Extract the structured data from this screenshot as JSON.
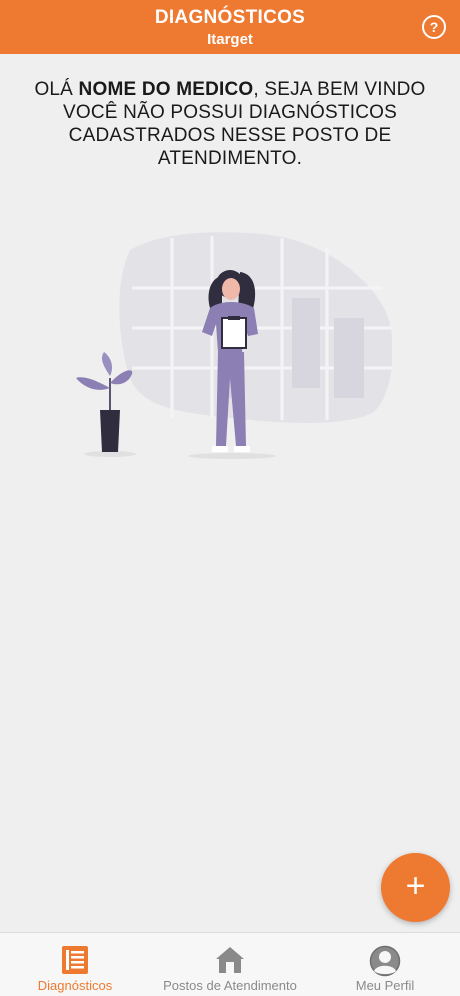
{
  "header": {
    "title": "DIAGNÓSTICOS",
    "subtitle": "Itarget",
    "help_label": "?"
  },
  "message": {
    "greeting": "OLÁ ",
    "doctor_name": "NOME DO MEDICO",
    "welcome": ", SEJA BEM VINDO",
    "empty_text": "VOCÊ NÃO POSSUI DIAGNÓSTICOS CADASTRADOS NESSE POSTO DE ATENDIMENTO."
  },
  "fab": {
    "label": "+"
  },
  "bottom_nav": {
    "items": [
      {
        "label": "Diagnósticos",
        "icon": "document-list-icon",
        "active": true
      },
      {
        "label": "Postos de Atendimento",
        "icon": "house-icon",
        "active": false
      },
      {
        "label": "Meu Perfil",
        "icon": "user-icon",
        "active": false
      }
    ]
  },
  "colors": {
    "brand": "#ee7930",
    "background": "#efefef",
    "inactive": "#8a8a8a"
  }
}
